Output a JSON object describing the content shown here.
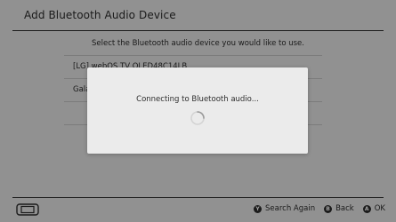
{
  "header": {
    "title": "Add Bluetooth Audio Device"
  },
  "main": {
    "instruction": "Select the Bluetooth audio device you would like to use.",
    "devices": [
      {
        "label": "[LG] webOS TV OLED48C14LB"
      },
      {
        "label": "Galaxy Buds"
      },
      {
        "label": ""
      }
    ]
  },
  "dialog": {
    "message": "Connecting to Bluetooth audio..."
  },
  "footer": {
    "console_icon": "handheld-console-icon",
    "actions": [
      {
        "glyph": "Y",
        "label": "Search Again"
      },
      {
        "glyph": "B",
        "label": "Back"
      },
      {
        "glyph": "A",
        "label": "OK"
      }
    ]
  },
  "colors": {
    "background": "#ebebeb",
    "text": "#2d2d2d",
    "overlay": "rgba(0,0,0,0.38)"
  }
}
